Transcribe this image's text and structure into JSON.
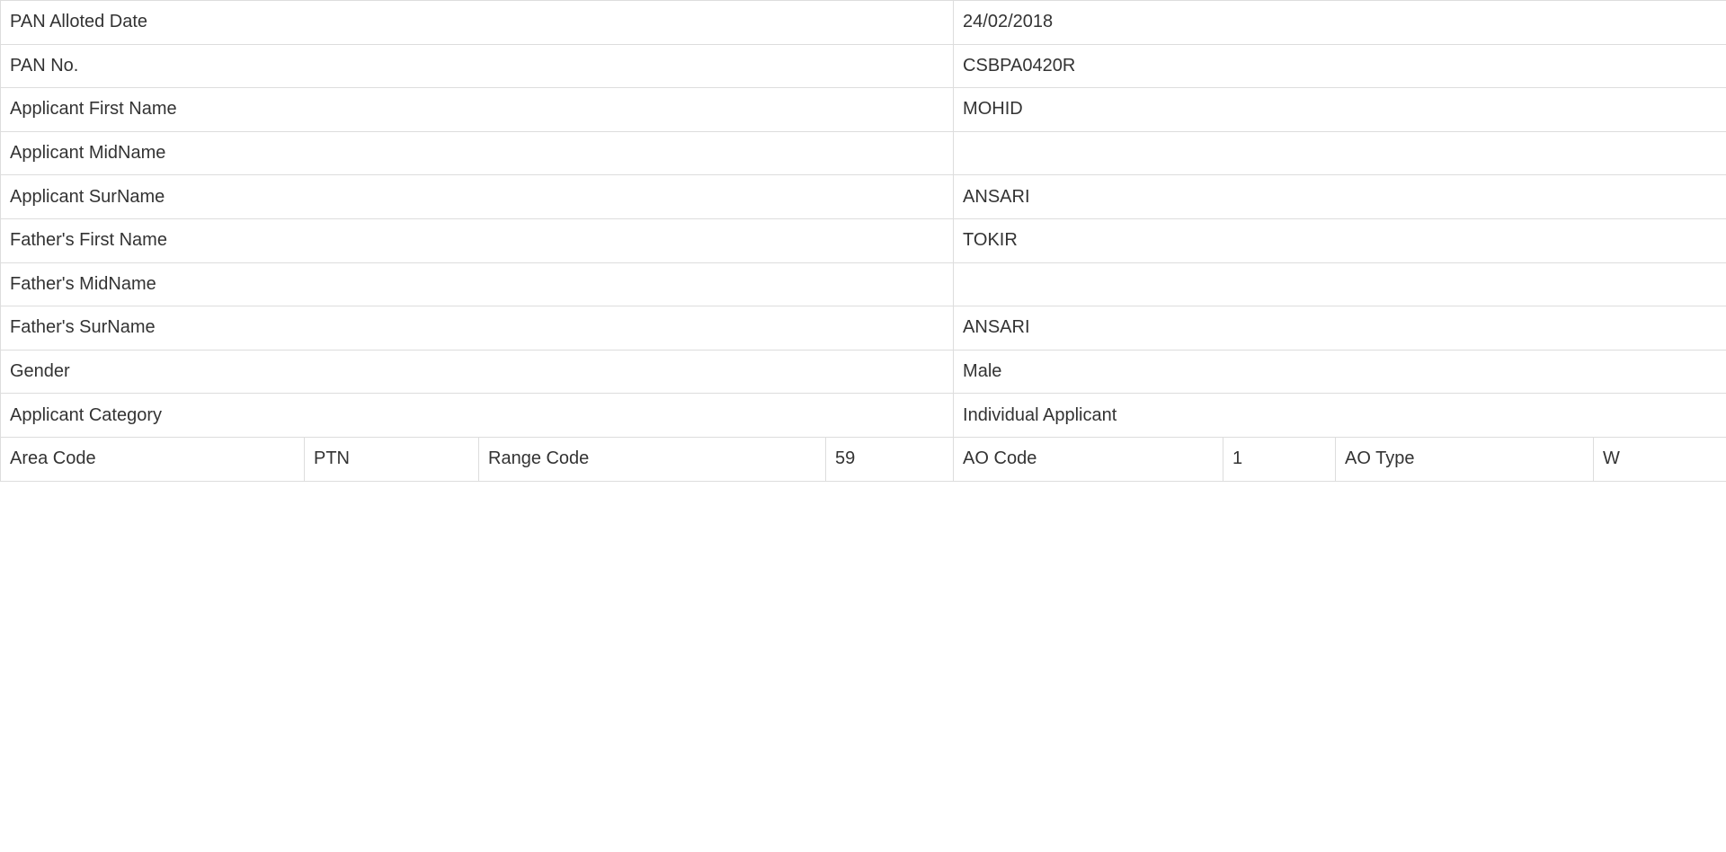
{
  "details": {
    "rows": [
      {
        "label": "PAN Alloted Date",
        "value": "24/02/2018"
      },
      {
        "label": "PAN No.",
        "value": "CSBPA0420R"
      },
      {
        "label": "Applicant First Name",
        "value": "MOHID"
      },
      {
        "label": "Applicant MidName",
        "value": ""
      },
      {
        "label": "Applicant SurName",
        "value": "ANSARI"
      },
      {
        "label": "Father's First Name",
        "value": "TOKIR"
      },
      {
        "label": "Father's MidName",
        "value": ""
      },
      {
        "label": "Father's SurName",
        "value": "ANSARI"
      },
      {
        "label": "Gender",
        "value": "Male"
      },
      {
        "label": "Applicant Category",
        "value": "Individual Applicant"
      }
    ],
    "codes": {
      "area_code_label": "Area Code",
      "area_code_value": "PTN",
      "range_code_label": "Range Code",
      "range_code_value": "59",
      "ao_code_label": "AO Code",
      "ao_code_value": "1",
      "ao_type_label": "AO Type",
      "ao_type_value": "W"
    }
  }
}
